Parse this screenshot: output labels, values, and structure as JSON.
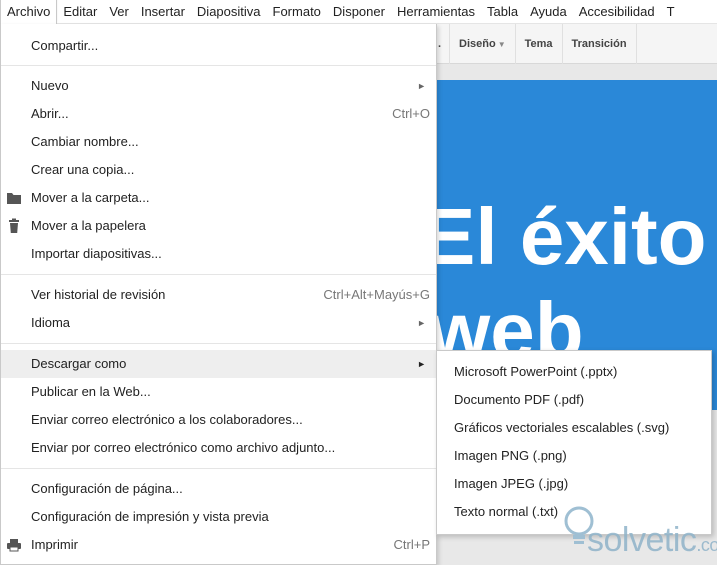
{
  "menubar": {
    "items": [
      "Archivo",
      "Editar",
      "Ver",
      "Insertar",
      "Diapositiva",
      "Formato",
      "Disponer",
      "Herramientas",
      "Tabla",
      "Ayuda",
      "Accesibilidad",
      "T"
    ]
  },
  "toolbar": {
    "buttons": [
      ".",
      "Diseño",
      "Tema",
      "Transición"
    ]
  },
  "slide": {
    "line1": "El éxito",
    "line2": "web"
  },
  "file_menu": {
    "share": "Compartir...",
    "new": "Nuevo",
    "open": "Abrir...",
    "open_shortcut": "Ctrl+O",
    "rename": "Cambiar nombre...",
    "copy": "Crear una copia...",
    "move_folder": "Mover a la carpeta...",
    "move_trash": "Mover a la papelera",
    "import_slides": "Importar diapositivas...",
    "revision_history": "Ver historial de revisión",
    "revision_shortcut": "Ctrl+Alt+Mayús+G",
    "language": "Idioma",
    "download_as": "Descargar como",
    "publish": "Publicar en la Web...",
    "email_collaborators": "Enviar correo electrónico a los colaboradores...",
    "email_attachment": "Enviar por correo electrónico como archivo adjunto...",
    "page_setup": "Configuración de página...",
    "print_setup": "Configuración de impresión y vista previa",
    "print": "Imprimir",
    "print_shortcut": "Ctrl+P",
    "submenu_arrow": "►"
  },
  "download_submenu": {
    "items": [
      "Microsoft PowerPoint (.pptx)",
      "Documento PDF (.pdf)",
      "Gráficos vectoriales escalables (.svg)",
      "Imagen PNG (.png)",
      "Imagen JPEG (.jpg)",
      "Texto normal (.txt)"
    ]
  },
  "watermark": {
    "main": "solvetic",
    "suffix": ".com"
  },
  "colors": {
    "slide_blue": "#2a88d8",
    "highlight": "#eeeeee",
    "watermark": "#8fb3c9"
  },
  "icons": {
    "folder": "folder-icon",
    "trash": "trash-icon",
    "print": "printer-icon"
  }
}
